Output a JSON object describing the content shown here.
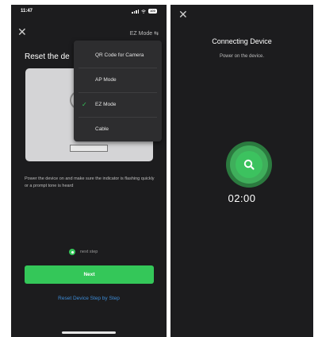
{
  "left_screen": {
    "status_time": "11:47",
    "battery_text": "100",
    "mode_switch_label": "EZ Mode",
    "title": "Reset the de",
    "menu": {
      "items": [
        {
          "label": "QR Code for Camera",
          "selected": false
        },
        {
          "label": "AP Mode",
          "selected": false
        },
        {
          "label": "EZ Mode",
          "selected": true
        },
        {
          "label": "Cable",
          "selected": false
        }
      ],
      "check_color": "#34c759"
    },
    "instruction": "Power the device on and make sure the indicator is flashing quickly or a prompt tone is heard",
    "next_step_label": "next step",
    "next_button": "Next",
    "reset_link": "Reset Device Step by Step"
  },
  "right_screen": {
    "title": "Connecting Device",
    "subtitle": "Power on the device.",
    "countdown": "02:00"
  },
  "colors": {
    "background": "#1c1c1e",
    "accent": "#34c759",
    "link": "#3d8bd6"
  },
  "icons": [
    "close-icon",
    "swap-icon",
    "check-icon",
    "search-icon",
    "signal-icon",
    "wifi-icon",
    "battery-icon"
  ]
}
